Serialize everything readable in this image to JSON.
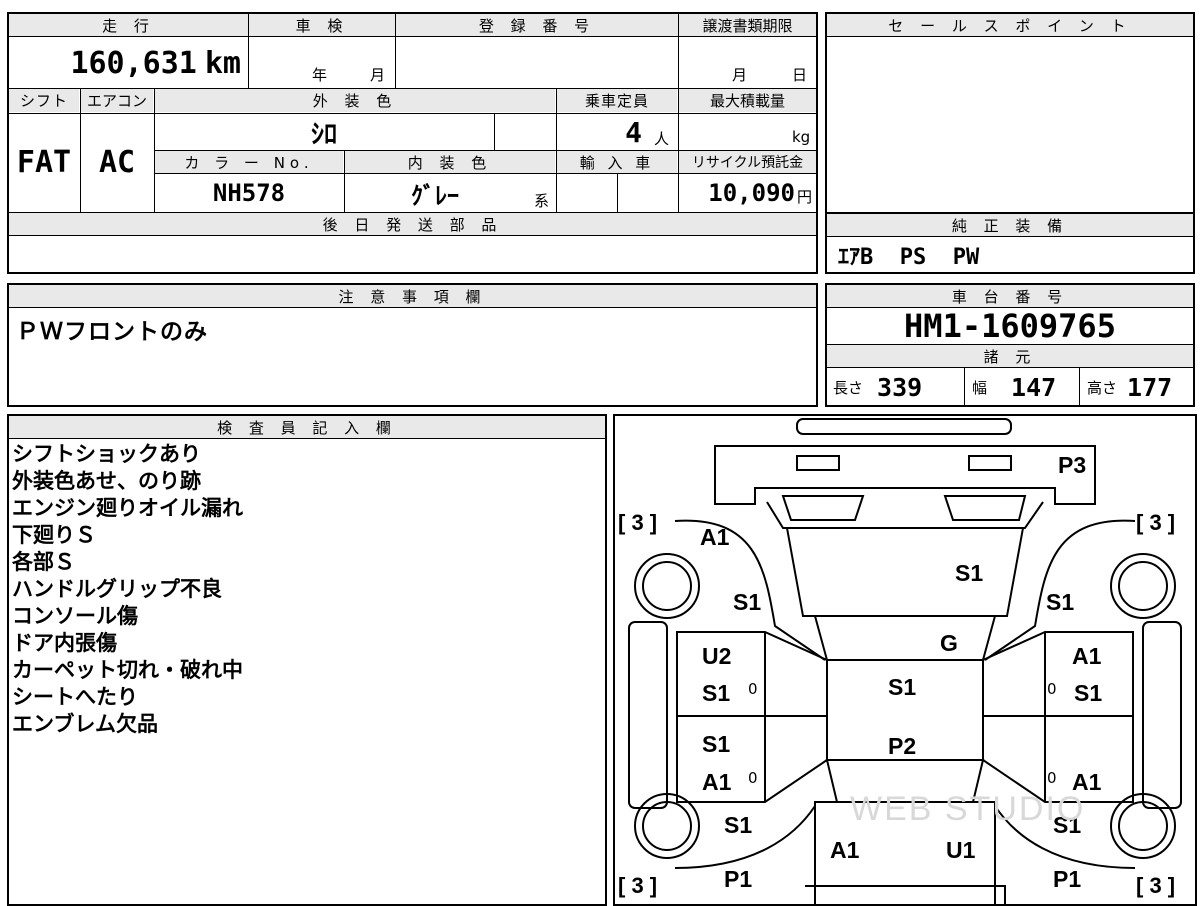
{
  "top": {
    "mileage_header": "走 行",
    "mileage_value": "160,631",
    "mileage_unit": "km",
    "inspection_header": "車 検",
    "inspection_year": "年",
    "inspection_month": "月",
    "reg_header": "登 録 番 号",
    "transfer_header": "譲渡書類期限",
    "transfer_month": "月",
    "transfer_day": "日",
    "shift_header": "シフト",
    "shift_value": "FAT",
    "ac_header": "エアコン",
    "ac_value": "AC",
    "exterior_header": "外 装 色",
    "exterior_value": "ｼﾛ",
    "capacity_header": "乗車定員",
    "capacity_value": "4",
    "capacity_unit": "人",
    "load_header": "最大積載量",
    "load_unit": "kg",
    "color_no_header": "カ ラ ー No.",
    "color_no_value": "NH578",
    "interior_header": "内 装 色",
    "interior_value": "ｸﾞﾚｰ",
    "interior_suffix": "系",
    "import_header": "輸 入 車",
    "recycle_header": "リサイクル預託金",
    "recycle_value": "10,090",
    "recycle_unit": "円",
    "later_parts_header": "後 日 発 送 部 品"
  },
  "sales_point": {
    "header": "セ ー ル ス ポ イ ン ト"
  },
  "genuine": {
    "header": "純 正 装 備",
    "value": "ｴｱB  PS  PW"
  },
  "notes": {
    "header": "注 意 事 項 欄",
    "value": "ＰＷフロントのみ"
  },
  "chassis": {
    "header": "車 台 番 号",
    "value": "HM1-1609765"
  },
  "specs": {
    "header": "諸 元",
    "length_label": "長さ",
    "length_value": "339",
    "width_label": "幅",
    "width_value": "147",
    "height_label": "高さ",
    "height_value": "177"
  },
  "inspector": {
    "header": "検 査 員 記 入 欄",
    "lines": [
      "シフトショックあり",
      "外装色あせ、のり跡",
      "エンジン廻りオイル漏れ",
      "下廻りＳ",
      "各部Ｓ",
      "ハンドルグリップ不良",
      "コンソール傷",
      "ドア内張傷",
      "カーペット切れ・破れ中",
      "シートへたり",
      "エンブレム欠品"
    ]
  },
  "diagram": {
    "brackets": [
      "[ 3 ]",
      "[ 3 ]",
      "[ 3 ]",
      "[ 3 ]"
    ],
    "marks": [
      "P3",
      "A1",
      "S1",
      "S1",
      "S1",
      "G",
      "U2",
      "S1",
      "S1",
      "A1",
      "S1",
      "P2",
      "S1",
      "A1",
      "A1",
      "S1",
      "S1",
      "A1",
      "U1",
      "S1",
      "P1",
      "P1",
      "0",
      "0",
      "0",
      "0"
    ],
    "watermark": "WEB STUDIO"
  }
}
